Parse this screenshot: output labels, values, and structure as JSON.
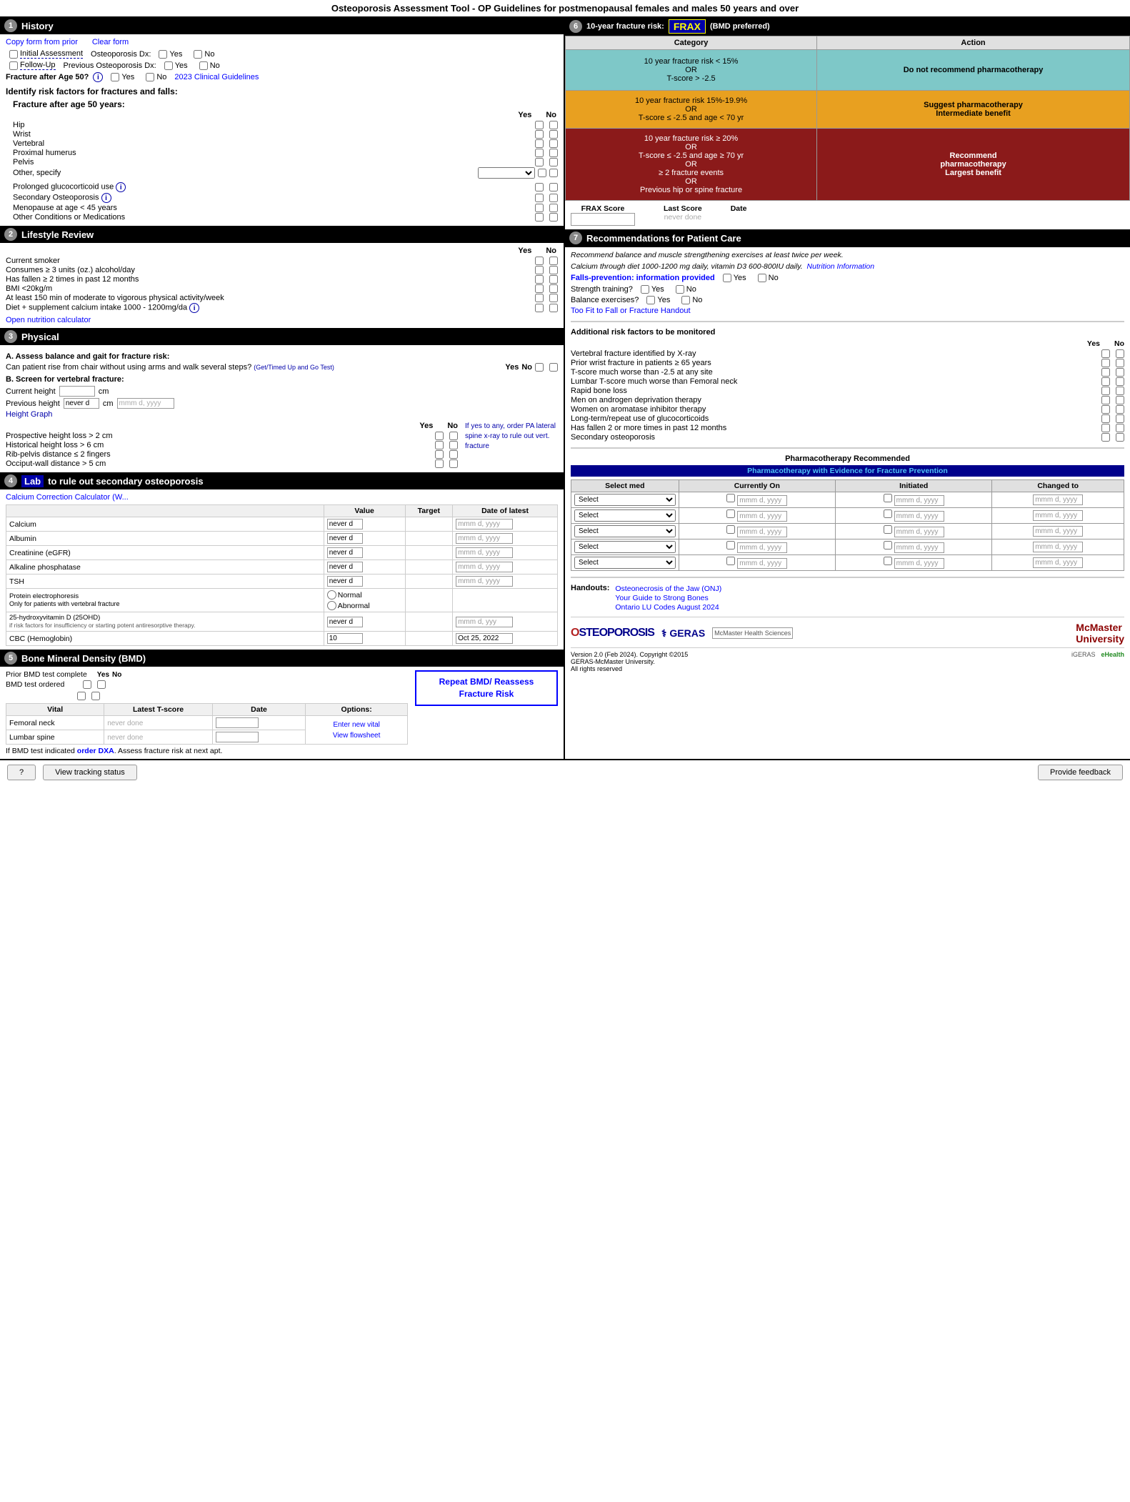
{
  "title": "Osteoporosis Assessment Tool - OP Guidelines for postmenopausal females and males 50 years and over",
  "sections": {
    "history": {
      "num": "1",
      "label": "History",
      "copy_form": "Copy form from prior",
      "clear_form": "Clear form",
      "initial_assessment": "Initial Assessment",
      "follow_up": "Follow-Up",
      "osteo_dx": "Osteoporosis Dx:",
      "prev_osteo_dx": "Previous Osteoporosis Dx:",
      "fracture_after_50": "Fracture after Age 50?",
      "guidelines_link": "2023 Clinical Guidelines",
      "identify_title": "Identify risk factors for fractures and falls:",
      "fracture_title": "Fracture after age 50 years:",
      "yes_label": "Yes",
      "no_label": "No",
      "fractures": [
        "Hip",
        "Wrist",
        "Vertebral",
        "Proximal humerus",
        "Pelvis",
        "Other, specify"
      ],
      "other_conditions": [
        "Prolonged glucocorticoid use",
        "Secondary Osteoporosis",
        "Menopause at age < 45 years",
        "Other Conditions or Medications"
      ]
    },
    "lifestyle": {
      "num": "2",
      "label": "Lifestyle Review",
      "items": [
        "Current smoker",
        "Consumes ≥ 3 units (oz.) alcohol/day",
        "Has fallen ≥ 2 times in past 12 months",
        "BMI <20kg/m",
        "At least 150 min of moderate to vigorous physical activity/week",
        "Diet + supplement calcium intake 1000 - 1200mg/da"
      ],
      "open_nutrition": "Open nutrition calculator"
    },
    "physical": {
      "num": "3",
      "label": "Physical",
      "assess_title": "A. Assess balance and gait for fracture risk:",
      "assess_q": "Can patient rise from chair without using arms and walk several steps?",
      "timed_link": "(Get/Timed Up and Go Test)",
      "screen_title": "B. Screen for vertebral fracture:",
      "current_height": "Current height",
      "prev_height": "Previous height",
      "prev_height_val": "never d",
      "height_graph": "Height Graph",
      "cm_label": "cm",
      "height_items": [
        "Prospective height loss > 2 cm",
        "Historical height loss > 6 cm",
        "Rib-pelvis distance ≤ 2 fingers",
        "Occiput-wall distance > 5 cm"
      ],
      "if_yes_note": "If yes to any, order PA lateral spine x-ray to rule out vert. fracture"
    },
    "lab": {
      "num": "4",
      "label": "Lab",
      "label_suffix": "to rule out secondary osteoporosis",
      "calc_link": "Calcium Correction Calculator (W...",
      "lab_cols": [
        "Value",
        "Target",
        "Date of latest"
      ],
      "lab_rows": [
        {
          "name": "Calcium",
          "value": "never d",
          "target": "",
          "date": "mmm d, yyyy"
        },
        {
          "name": "Albumin",
          "value": "never d",
          "target": "",
          "date": "mmm d, yyyy"
        },
        {
          "name": "Creatinine (eGFR)",
          "value": "never d",
          "target": "",
          "date": "mmm d, yyyy"
        },
        {
          "name": "Alkaline phosphatase",
          "value": "never d",
          "target": "",
          "date": "mmm d, yyyy"
        },
        {
          "name": "TSH",
          "value": "never d",
          "target": "",
          "date": "mmm d, yyyy"
        },
        {
          "name": "Protein electrophoresis\nOnly for patients with vertebral fracture",
          "value": "",
          "target": "",
          "date": ""
        },
        {
          "name": "25-hydroxyvitamin D (25OHD)\nif risk factors for insufficiency or starting potent antiresorptive therapy.",
          "value": "never d",
          "target": "",
          "date": "mmm d, yyy"
        },
        {
          "name": "CBC (Hemoglobin)",
          "value": "10",
          "target": "",
          "date": "Oct 25, 2022"
        }
      ]
    },
    "bmd": {
      "num": "5",
      "label": "Bone Mineral Density (BMD)",
      "prior_bmd": "Prior BMD test complete",
      "bmd_ordered": "BMD test ordered",
      "repeat_bmd": "Repeat BMD/ Reassess Fracture Risk",
      "vital_label": "Vital",
      "latest_tscore": "Latest T-score",
      "date_label": "Date",
      "options_label": "Options:",
      "enter_new": "Enter new vital",
      "view_flowsheet": "View flowsheet",
      "vitals": [
        {
          "name": "Femoral neck",
          "tscore": "never done",
          "date": ""
        },
        {
          "name": "Lumbar spine",
          "tscore": "never done",
          "date": ""
        }
      ],
      "dxa_note": "If BMD test indicated order DXA. Assess fracture risk at next apt."
    },
    "frax": {
      "num": "6",
      "label": "10-year fracture risk:",
      "badge": "FRAX",
      "badge_suffix": "(BMD preferred)",
      "cat_header": "Category",
      "action_header": "Action",
      "categories": [
        {
          "desc": "10 year fracture risk < 15%\nOR\nT-score > -2.5",
          "color": "green",
          "action": "Do not recommend pharmacotherapy",
          "action_color": "#7ec8c8"
        },
        {
          "desc": "10 year fracture risk 15%-19.9%\nOR\nT-score ≤ -2.5 and age < 70 yr",
          "color": "orange",
          "action": "Suggest pharmacotherapy Intermediate benefit",
          "action_color": "#e8a020"
        },
        {
          "desc": "10 year fracture risk ≥ 20%\nOR\nT-score ≤ -2.5 and age ≥ 70 yr\nOR\n≥ 2 fracture events\nOR\nPrevious hip or spine fracture",
          "color": "red",
          "action": "Recommend pharmacotherapy Largest benefit",
          "action_color": "#8b1a1a"
        }
      ],
      "frax_score": "FRAX Score",
      "last_score": "Last Score",
      "date_col": "Date",
      "never_done": "never done"
    },
    "recommendations": {
      "num": "7",
      "label": "Recommendations for Patient Care",
      "text1": "Recommend balance and muscle strengthening exercises at least twice per week.",
      "text2": "Calcium through diet 1000-1200 mg daily, vitamin D3 600-800IU daily.",
      "nutrition_link": "Nutrition Information",
      "falls_prev": "Falls-prevention: information provided",
      "strength": "Strength training?",
      "balance": "Balance exercises?",
      "handout_link": "Too Fit to Fall or Fracture Handout",
      "additional_title": "Additional risk factors to be monitored",
      "risk_items": [
        "Vertebral fracture identified by X-ray",
        "Prior wrist fracture in patients ≥ 65 years",
        "T-score much worse than -2.5 at any site",
        "Lumbar T-score much worse than Femoral neck",
        "Rapid bone loss",
        "Men on androgen deprivation therapy",
        "Women on aromatase inhibitor therapy",
        "Long-term/repeat use of glucocorticoids",
        "Has fallen 2 or more times in past 12 months",
        "Secondary osteoporosis"
      ],
      "pharma_title": "Pharmacotherapy Recommended",
      "pharma_subtitle": "Pharmacotherapy with Evidence for Fracture Prevention",
      "pharma_cols": [
        "Select med",
        "Currently On",
        "Initiated",
        "Changed to"
      ],
      "pharma_rows": [
        {
          "select": "Select"
        },
        {
          "select": "Select"
        },
        {
          "select": "Select"
        },
        {
          "select": "Select"
        },
        {
          "select": "Select"
        }
      ],
      "handouts_label": "Handouts:",
      "handout_links": [
        "Osteonecrosis of the Jaw (ONJ)",
        "Your Guide to Strong Bones",
        "Ontario LU Codes August 2024"
      ]
    }
  },
  "footer": {
    "question_mark": "?",
    "view_tracking": "View tracking status",
    "provide_feedback": "Provide feedback"
  },
  "logos": {
    "osteoporosis": "OSTEOPOROSIS",
    "geras": "GERAS",
    "mcmaster": "McMaster University",
    "version": "Version 2.0 (Feb 2024). Copyright ©2015",
    "org": "GERAS-McMaster University.",
    "rights": "All rights reserved"
  }
}
